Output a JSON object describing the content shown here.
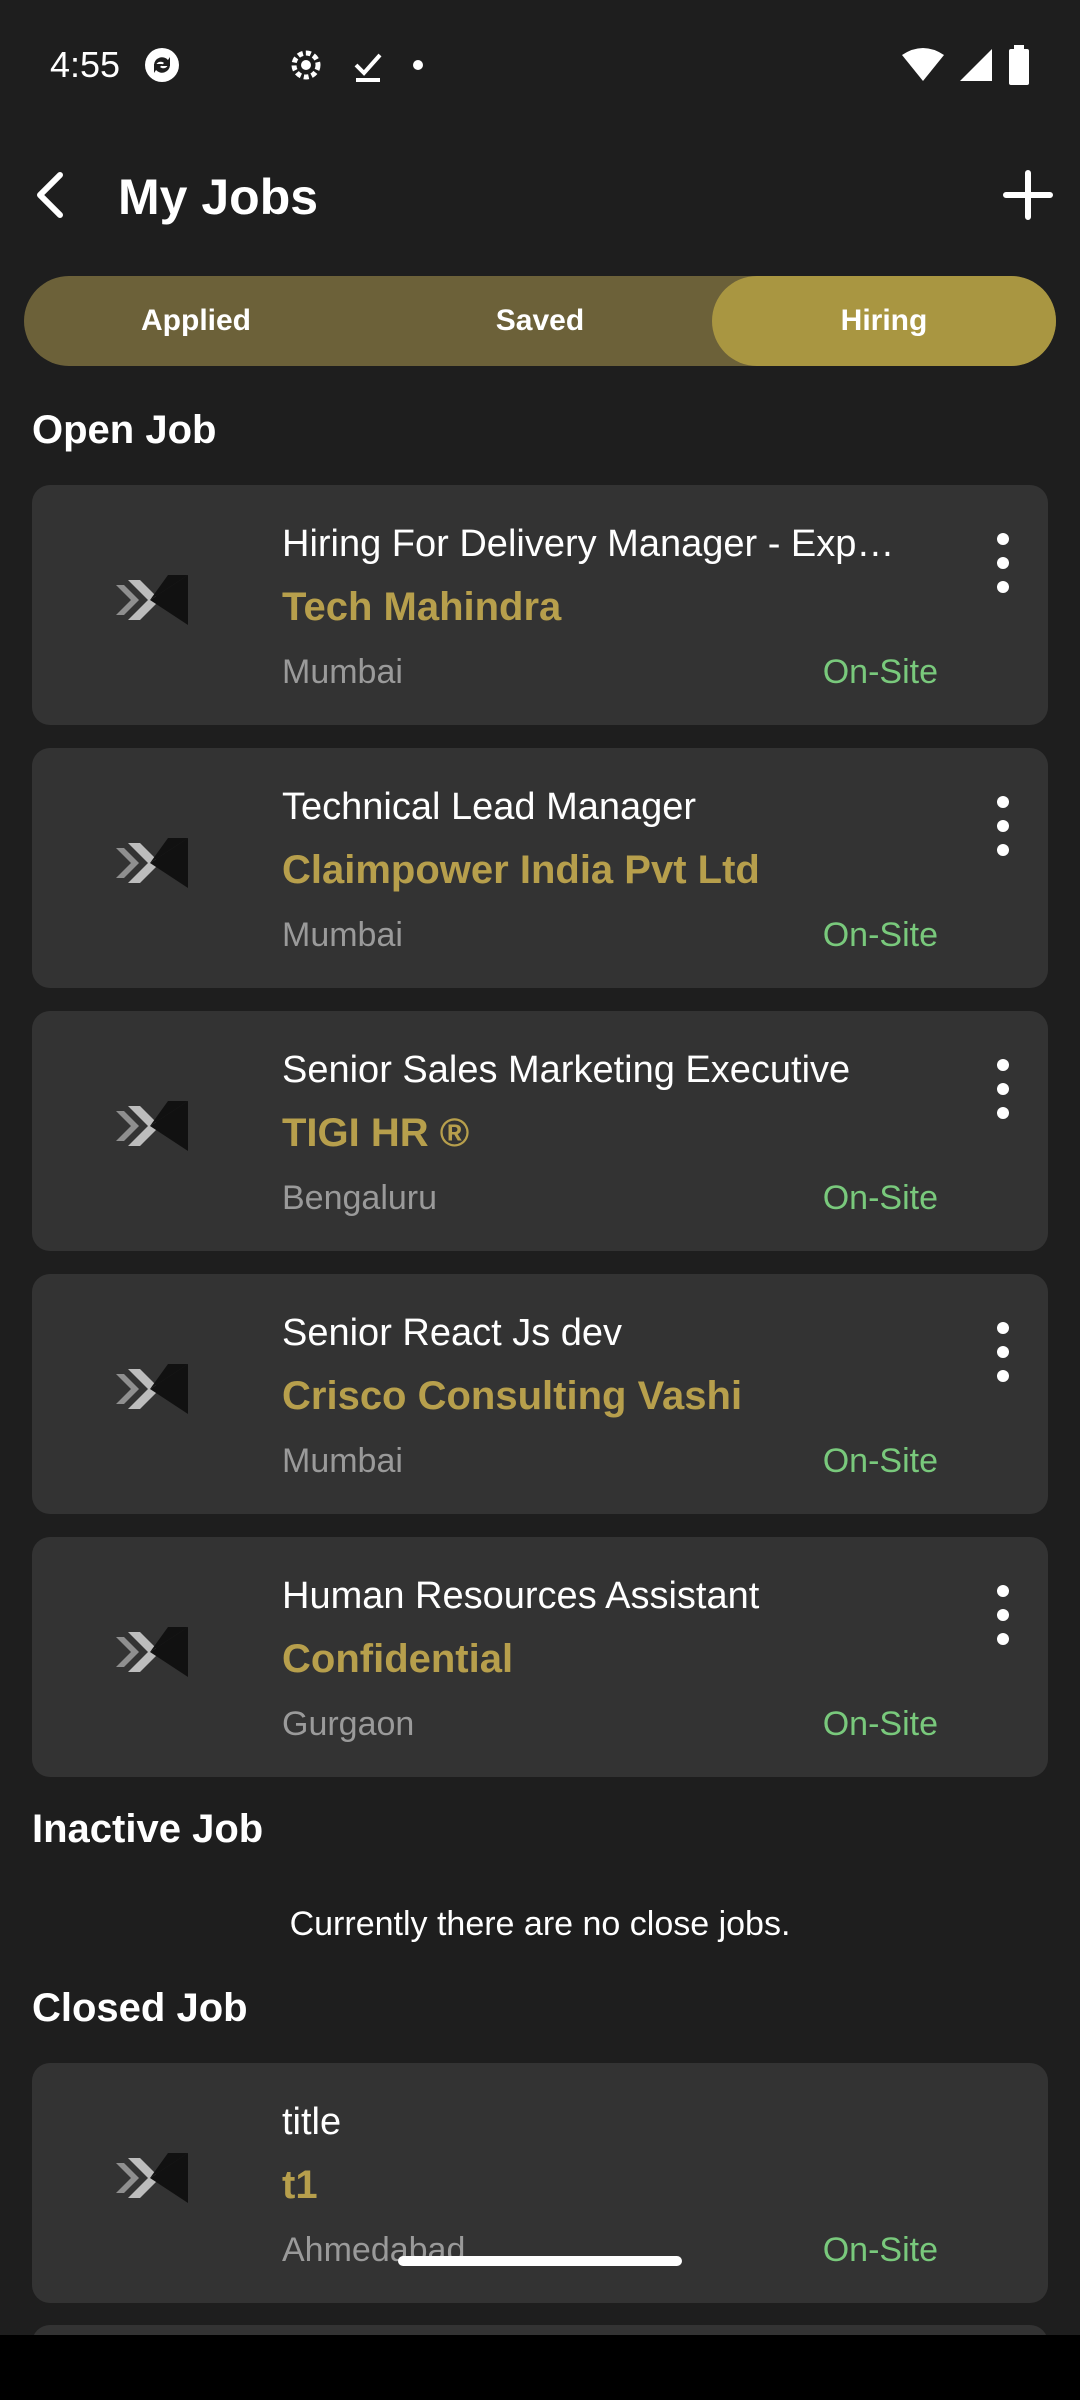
{
  "status_bar": {
    "time": "4:55",
    "icons_left": [
      "sync-icon",
      "settings-icon",
      "download-done-icon",
      "dot-icon"
    ],
    "icons_right": [
      "wifi-icon",
      "signal-icon",
      "battery-icon"
    ]
  },
  "header": {
    "title": "My Jobs"
  },
  "tabs": [
    {
      "label": "Applied",
      "active": false
    },
    {
      "label": "Saved",
      "active": false
    },
    {
      "label": "Hiring",
      "active": true
    }
  ],
  "sections": {
    "open_title": "Open Job",
    "inactive_title": "Inactive Job",
    "inactive_empty": "Currently there are no close jobs.",
    "closed_title": "Closed Job"
  },
  "open_jobs": [
    {
      "title": "Hiring For Delivery Manager - Exp…",
      "company": "Tech Mahindra",
      "location": "Mumbai",
      "type": "On-Site"
    },
    {
      "title": "Technical Lead Manager",
      "company": "Claimpower India Pvt Ltd",
      "location": "Mumbai",
      "type": "On-Site"
    },
    {
      "title": "Senior Sales Marketing Executive",
      "company": "TIGI HR ®",
      "location": "Bengaluru",
      "type": "On-Site"
    },
    {
      "title": "Senior React Js dev",
      "company": "Crisco Consulting Vashi",
      "location": "Mumbai",
      "type": "On-Site"
    },
    {
      "title": "Human Resources Assistant",
      "company": "Confidential",
      "location": "Gurgaon",
      "type": "On-Site"
    }
  ],
  "closed_jobs": [
    {
      "title": "title",
      "company": "t1",
      "location": "Ahmedabad",
      "type": "On-Site"
    }
  ],
  "colors": {
    "background": "#1e1e1e",
    "card": "#333333",
    "accent": "#a99641",
    "company": "#b79f4c",
    "onsite": "#79c97c"
  }
}
